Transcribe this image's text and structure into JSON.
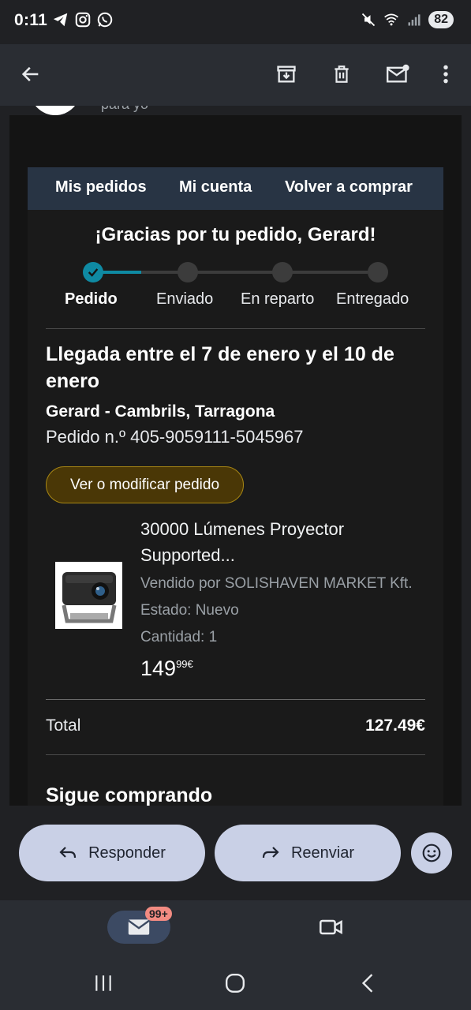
{
  "status": {
    "time": "0:11",
    "battery": "82"
  },
  "email": {
    "to_me": "para yo",
    "nav": {
      "orders": "Mis pedidos",
      "account": "Mi cuenta",
      "buy_again": "Volver a comprar"
    },
    "thanks": "¡Gracias por tu pedido, Gerard!",
    "steps": [
      "Pedido",
      "Enviado",
      "En reparto",
      "Entregado"
    ],
    "arrival": "Llegada entre el 7 de enero y el 10 de enero",
    "address": "Gerard - Cambrils, Tarragona",
    "order_number": "Pedido n.º 405-9059111-5045967",
    "view_button": "Ver o modificar pedido",
    "product": {
      "title": "30000 Lúmenes Proyector Supported...",
      "seller": "Vendido por SOLISHAVEN MARKET Kft.",
      "condition": "Estado: Nuevo",
      "quantity": "Cantidad: 1",
      "price_whole": "149",
      "price_fraction": "99€"
    },
    "total_label": "Total",
    "total_value": "127.49€",
    "keep_shopping": "Sigue comprando"
  },
  "actions": {
    "reply": "Responder",
    "forward": "Reenviar"
  },
  "bottom_nav": {
    "mail_badge": "99+"
  },
  "colors": {
    "accent_progress": "#0f8aa3",
    "nav_bg": "#283444",
    "pill_bg": "#c9d0e6",
    "order_button_bg": "#4a3706"
  }
}
